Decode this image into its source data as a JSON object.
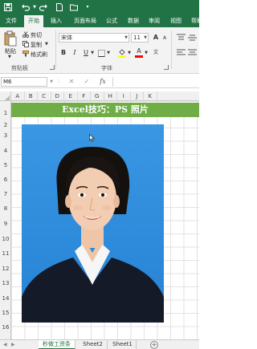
{
  "colors": {
    "accent": "#217346",
    "banner": "#70ad47",
    "photo_background": "#2f8fde"
  },
  "quick_access": {
    "save_icon": "save-icon",
    "undo_icon": "undo-icon",
    "redo_icon": "redo-icon",
    "new_icon": "new-document-icon",
    "open_icon": "open-folder-icon"
  },
  "tabs": [
    "文件",
    "开始",
    "插入",
    "页面布局",
    "公式",
    "数据",
    "审阅",
    "视图",
    "帮助"
  ],
  "active_tab": "开始",
  "clipboard": {
    "paste": "粘贴",
    "cut": "剪切",
    "copy": "复制",
    "format_painter": "格式刷",
    "group_label": "剪贴板"
  },
  "font_group": {
    "font_name": "宋体",
    "font_size": "11",
    "bold": "B",
    "italic": "I",
    "underline": "U",
    "grow": "A",
    "shrink": "A",
    "font_color_glyph": "A",
    "group_label": "字体"
  },
  "formula_bar": {
    "name_box": "M6",
    "cancel": "✕",
    "enter": "✓",
    "fx": "fx",
    "value": ""
  },
  "columns": [
    "A",
    "B",
    "C",
    "D",
    "E",
    "F",
    "G",
    "H",
    "I",
    "J",
    "K"
  ],
  "rows": [
    "1",
    "2",
    "3",
    "4",
    "5",
    "6",
    "7",
    "8",
    "9",
    "10",
    "11",
    "12",
    "13",
    "14",
    "15",
    "16"
  ],
  "banner": "Excel技巧：PS 照片",
  "sheets": [
    "秒做工资条",
    "Sheet2",
    "Sheet1"
  ],
  "active_sheet": "秒做工资条",
  "sheet_nav": {
    "prev": "◀",
    "next": "▶"
  },
  "add_sheet": "+"
}
